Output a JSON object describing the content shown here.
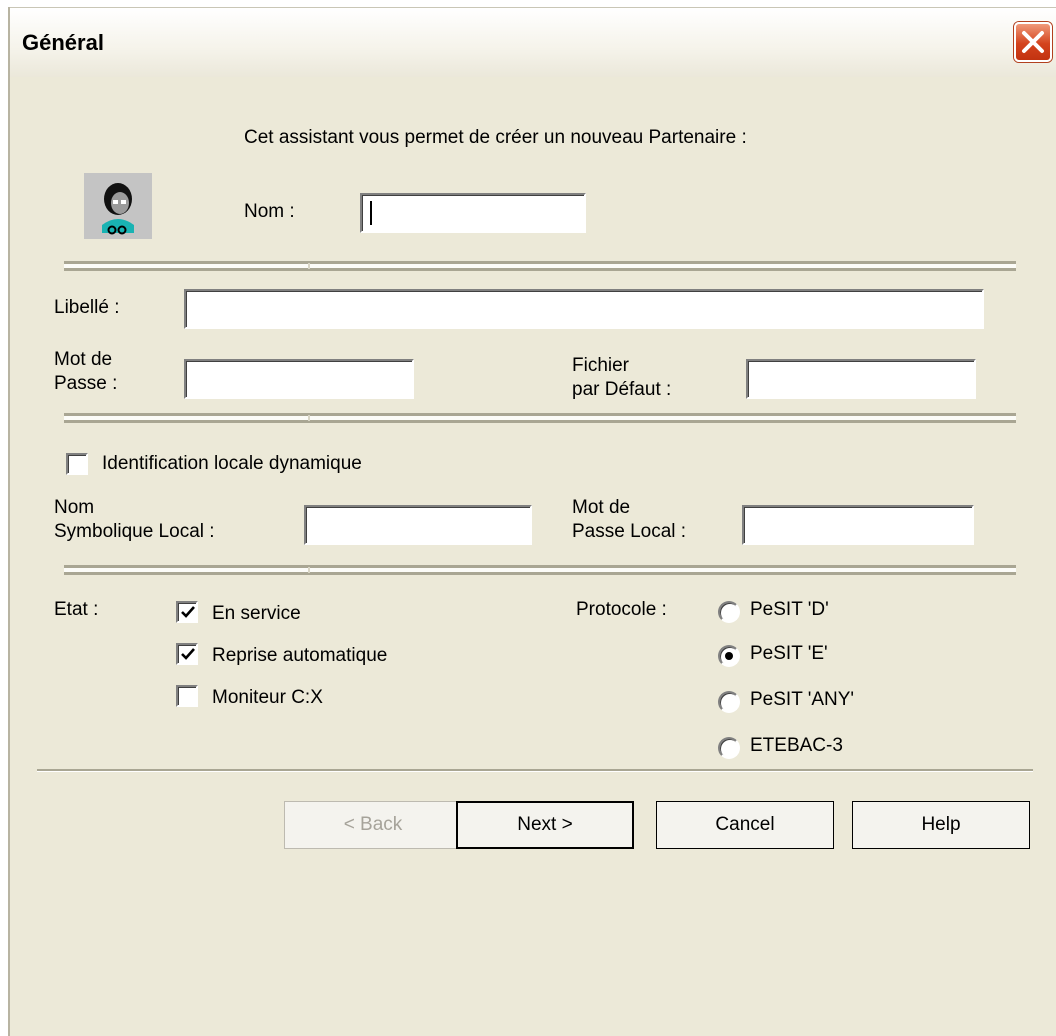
{
  "window": {
    "title": "Général"
  },
  "intro": "Cet assistant vous permet de créer un nouveau Partenaire :",
  "fields": {
    "nom": {
      "label": "Nom :",
      "value": ""
    },
    "libelle": {
      "label": "Libellé :",
      "value": ""
    },
    "mot_de_passe": {
      "label_line1": "Mot de",
      "label_line2": "Passe :",
      "value": ""
    },
    "fichier_defaut": {
      "label_line1": "Fichier",
      "label_line2": "par Défaut :",
      "value": ""
    },
    "nom_symbolique_local": {
      "label_line1": "Nom",
      "label_line2": "Symbolique Local :",
      "value": ""
    },
    "mot_de_passe_local": {
      "label_line1": "Mot de",
      "label_line2": "Passe Local :",
      "value": ""
    }
  },
  "identification": {
    "label": "Identification locale dynamique",
    "checked": false
  },
  "etat": {
    "label": "Etat :",
    "options": [
      {
        "label": "En service",
        "checked": true
      },
      {
        "label": "Reprise automatique",
        "checked": true
      },
      {
        "label": "Moniteur C:X",
        "checked": false
      }
    ]
  },
  "protocole": {
    "label": "Protocole :",
    "options": [
      {
        "label": "PeSIT 'D'",
        "selected": false
      },
      {
        "label": "PeSIT 'E'",
        "selected": true
      },
      {
        "label": "PeSIT 'ANY'",
        "selected": false
      },
      {
        "label": "ETEBAC-3",
        "selected": false
      }
    ]
  },
  "buttons": {
    "back": "< Back",
    "next": "Next >",
    "cancel": "Cancel",
    "help": "Help"
  },
  "icons": {
    "close": "close-icon",
    "avatar": "user-avatar-icon",
    "check": "checkmark-icon"
  },
  "colors": {
    "close_button": "#d4431d",
    "dialog_bg": "#ece9d8"
  }
}
